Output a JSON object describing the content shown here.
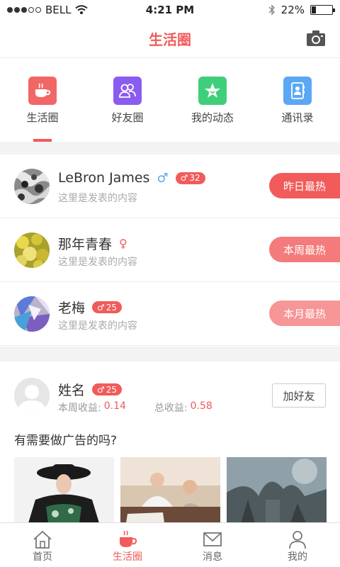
{
  "status_bar": {
    "carrier": "BELL",
    "time": "4:21 PM",
    "battery": "22%"
  },
  "nav": {
    "title": "生活圈"
  },
  "tabs": [
    {
      "label": "生活圈",
      "icon": "coffee-cup-icon",
      "color": "#f26666"
    },
    {
      "label": "好友圈",
      "icon": "friends-icon",
      "color": "#8b5cf0"
    },
    {
      "label": "我的动态",
      "icon": "star-icon",
      "color": "#3fcf7a"
    },
    {
      "label": "通讯录",
      "icon": "contacts-icon",
      "color": "#5aa8f5"
    }
  ],
  "feed": [
    {
      "name": "LeBron James",
      "gender": "♂",
      "age": "32",
      "subtitle": "这里是发表的内容",
      "hot_label": "昨日最热",
      "hot_color": "#f15b5b"
    },
    {
      "name": "那年青春",
      "gender": "♀",
      "age": "",
      "subtitle": "这里是发表的内容",
      "hot_label": "本周最热",
      "hot_color": "#f47b7b"
    },
    {
      "name": "老梅",
      "gender": "♂",
      "age": "25",
      "subtitle": "这里是发表的内容",
      "hot_label": "本月最热",
      "hot_color": "#f69696"
    }
  ],
  "profile": {
    "name": "姓名",
    "gender": "♂",
    "age": "25",
    "week_label": "本周收益:",
    "week_value": "0.14",
    "total_label": "总收益:",
    "total_value": "0.58",
    "add_friend": "加好友"
  },
  "ad": {
    "question": "有需要做广告的吗?"
  },
  "tabbar": [
    {
      "label": "首页",
      "icon": "home-icon"
    },
    {
      "label": "生活圈",
      "icon": "coffee-cup-icon"
    },
    {
      "label": "消息",
      "icon": "mail-icon"
    },
    {
      "label": "我的",
      "icon": "user-icon"
    }
  ],
  "colors": {
    "accent": "#f15b5b",
    "muted": "#aaaaaa"
  }
}
